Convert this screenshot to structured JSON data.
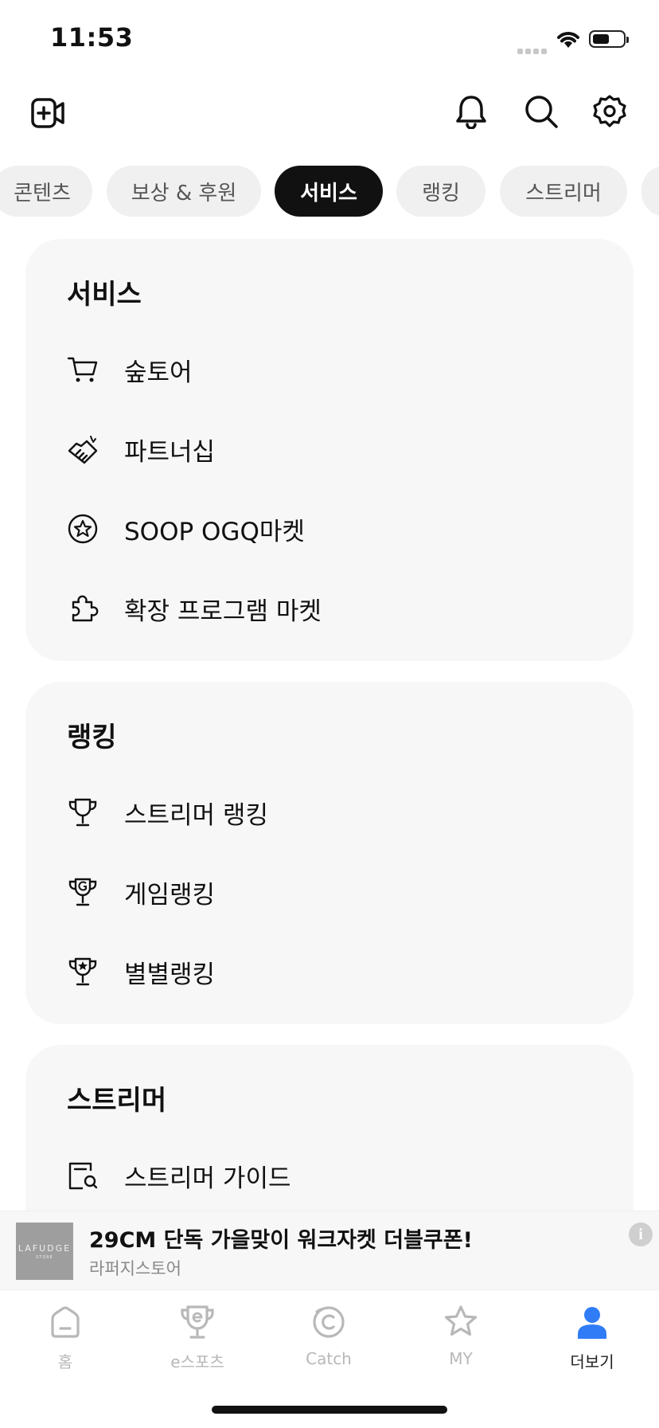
{
  "status": {
    "time": "11:53"
  },
  "icons": {
    "add_video": "add-video-icon",
    "bell": "bell-icon",
    "search": "search-icon",
    "settings": "gear-icon"
  },
  "chips": [
    "콘텐츠",
    "보상 & 후원",
    "서비스",
    "랭킹",
    "스트리머"
  ],
  "active_chip": "서비스",
  "sections": {
    "service": {
      "title": "서비스",
      "items": [
        "숲토어",
        "파트너십",
        "SOOP OGQ마켓",
        "확장 프로그램 마켓"
      ]
    },
    "ranking": {
      "title": "랭킹",
      "items": [
        "스트리머 랭킹",
        "게임랭킹",
        "별별랭킹"
      ]
    },
    "streamer": {
      "title": "스트리머",
      "items": [
        "스트리머 가이드"
      ]
    }
  },
  "ad": {
    "thumb_brand": "LAFUDGE",
    "thumb_sub": "STORE",
    "title": "29CM 단독 가을맞이 워크자켓 더블쿠폰!",
    "subtitle": "라퍼지스토어",
    "info_glyph": "i"
  },
  "tabs": [
    {
      "label": "홈",
      "icon": "home-icon"
    },
    {
      "label": "e스포츠",
      "icon": "esports-trophy-icon"
    },
    {
      "label": "Catch",
      "icon": "catch-icon"
    },
    {
      "label": "MY",
      "icon": "star-icon"
    },
    {
      "label": "더보기",
      "icon": "profile-icon"
    }
  ],
  "colors": {
    "accent": "#2f7cf6",
    "card_bg": "#f7f7f8",
    "chip_active": "#111111"
  }
}
